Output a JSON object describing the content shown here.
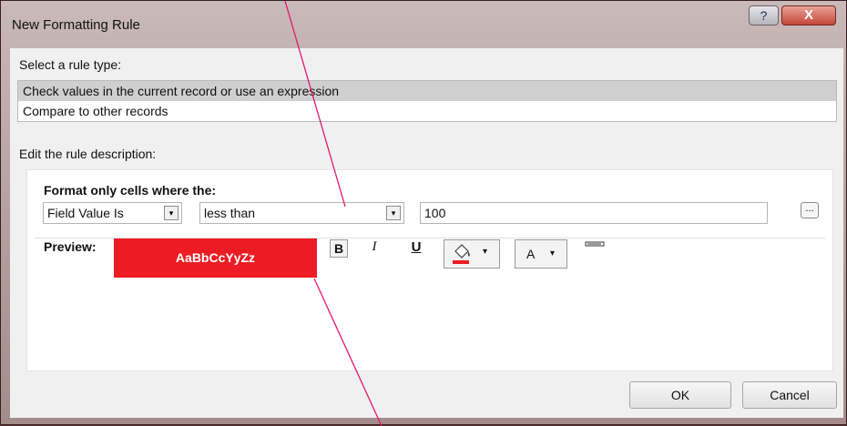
{
  "window": {
    "title": "New Formatting Rule",
    "help_glyph": "?",
    "close_glyph": "X"
  },
  "rule_type": {
    "label": "Select a rule type:",
    "items": [
      {
        "label": "Check values in the current record or use an expression",
        "selected": true
      },
      {
        "label": "Compare to other records",
        "selected": false
      }
    ]
  },
  "description": {
    "label": "Edit the rule description:",
    "condition_label": "Format only cells where the:",
    "field_combo_value": "Field Value Is",
    "operator_combo_value": "less than",
    "value_input": "100",
    "ellipsis_label": "..."
  },
  "preview": {
    "label": "Preview:",
    "sample_text": "AaBbCcYyZz",
    "fill_color": "#ed1c24",
    "text_color": "#ffffff"
  },
  "format_toolbar": {
    "bold_label": "B",
    "italic_label": "I",
    "underline_label": "U",
    "font_color_label": "A",
    "dropdown_glyph": "▾"
  },
  "buttons": {
    "ok_label": "OK",
    "cancel_label": "Cancel"
  }
}
